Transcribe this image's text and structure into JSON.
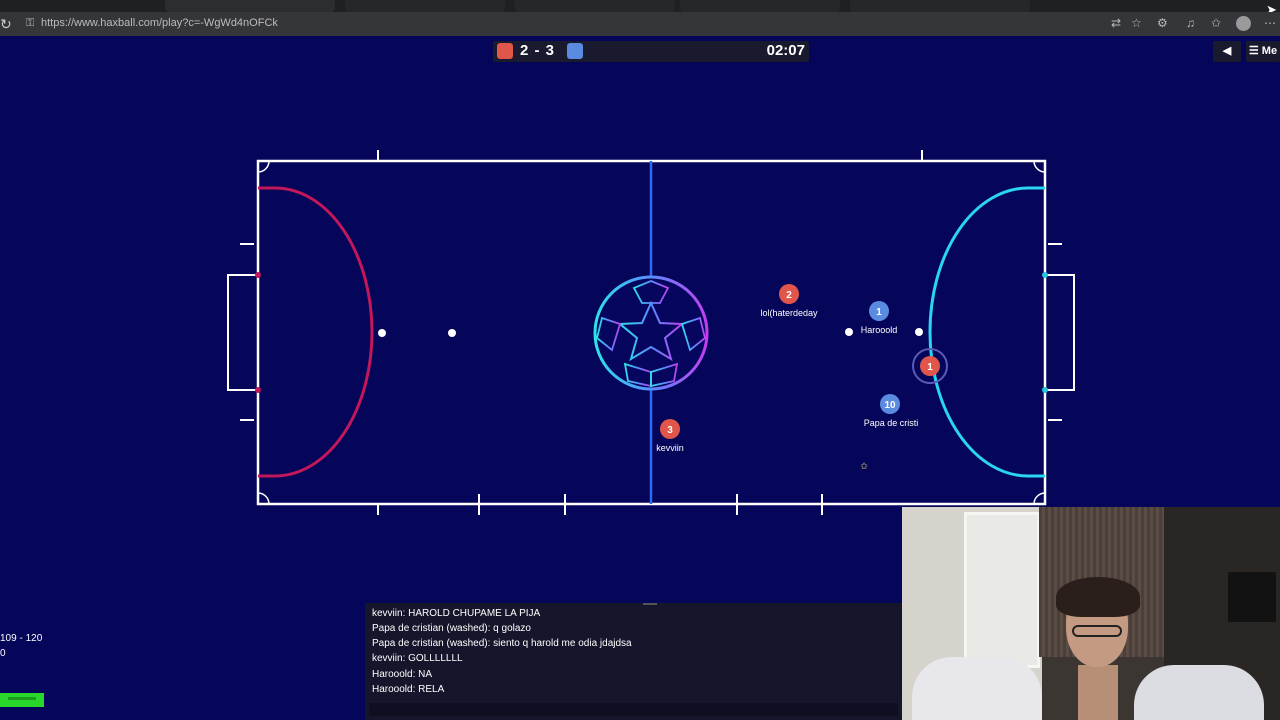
{
  "browser": {
    "url": "https://www.haxball.com/play?c=-WgWd4nOFCk",
    "icons": [
      "reload-icon",
      "lock-icon",
      "translate-icon",
      "star-icon",
      "extension-icon",
      "media-icon",
      "favorites-icon",
      "profile-icon",
      "more-icon"
    ]
  },
  "hud": {
    "score": "2 - 3",
    "timer": "02:07",
    "red_color": "#e0564a",
    "blue_color": "#5b8be0",
    "sound_button": "◀",
    "menu_button": "☰ Me"
  },
  "field": {
    "ball_style": "champions-league-star-ball",
    "players": [
      {
        "team": "red",
        "number": "2",
        "name": "lol(haterdeday"
      },
      {
        "team": "blue",
        "number": "1",
        "name": "Harooold"
      },
      {
        "team": "red",
        "number": "1",
        "name": ""
      },
      {
        "team": "blue",
        "number": "10",
        "name": "Papa de cristi"
      },
      {
        "team": "red",
        "number": "3",
        "name": "kevviin"
      }
    ]
  },
  "chat": {
    "messages": [
      "kevviin: HAROLD CHUPAME LA PIJA",
      "Papa de cristian (washed): q golazo",
      "Papa de cristian (washed): siento q harold me odia jdajdsa",
      "kevviin: GOLLLLLLL",
      "Harooold: NA",
      "Harooold: RELA"
    ]
  },
  "stats": {
    "line1": "109 - 120",
    "line2": "0"
  }
}
